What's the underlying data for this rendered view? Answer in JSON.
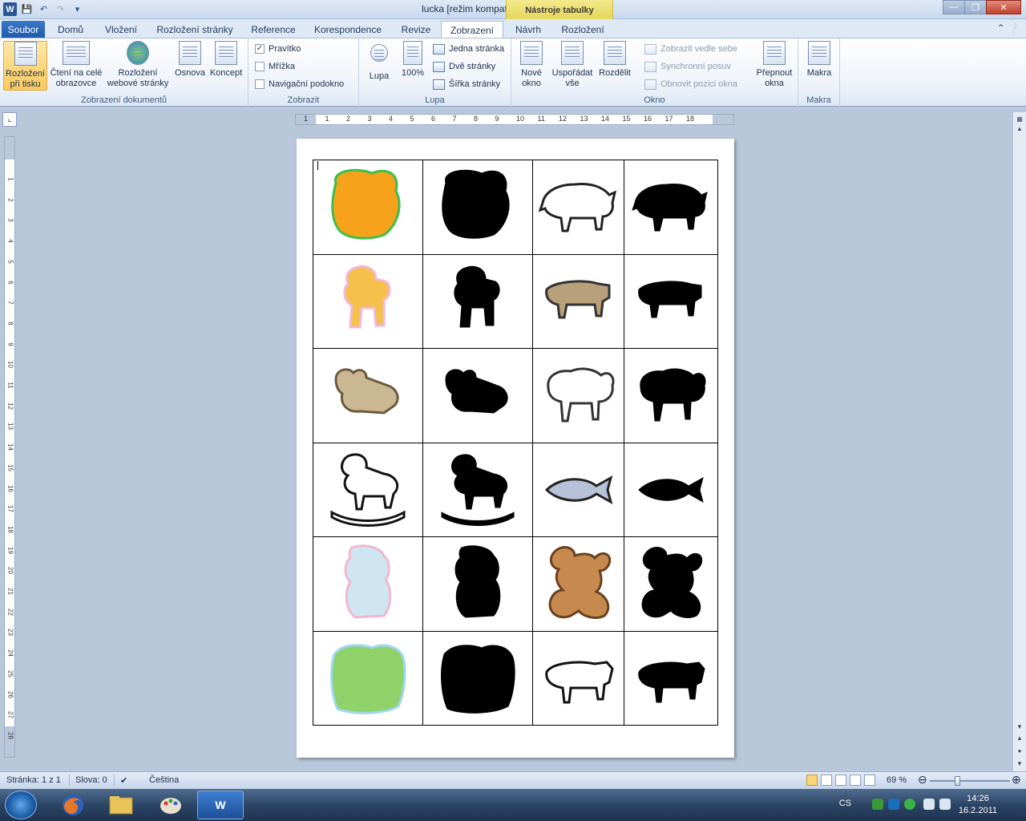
{
  "window": {
    "title": "lucka [režim kompatibility]  -  Microsoft Word",
    "contextual_tab": "Nástroje tabulky"
  },
  "tabs": {
    "file": "Soubor",
    "items": [
      "Domů",
      "Vložení",
      "Rozložení stránky",
      "Reference",
      "Korespondence",
      "Revize",
      "Zobrazení",
      "Návrh",
      "Rozložení"
    ],
    "active": "Zobrazení"
  },
  "ribbon": {
    "doc_views": {
      "label": "Zobrazení dokumentů",
      "print_layout": "Rozložení\npři tisku",
      "full_screen": "Čtení na celé\nobrazovce",
      "web_layout": "Rozložení\nwebové stránky",
      "outline": "Osnova",
      "draft": "Koncept"
    },
    "show": {
      "label": "Zobrazit",
      "ruler": "Pravítko",
      "ruler_checked": true,
      "gridlines": "Mřížka",
      "gridlines_checked": false,
      "nav_pane": "Navigační podokno",
      "nav_pane_checked": false
    },
    "zoom": {
      "label": "Lupa",
      "zoom": "Lupa",
      "hundred": "100%",
      "one_page": "Jedna stránka",
      "two_pages": "Dvě stránky",
      "page_width": "Šířka stránky"
    },
    "window": {
      "label": "Okno",
      "new_window": "Nové\nokno",
      "arrange_all": "Uspořádat\nvše",
      "split": "Rozdělit",
      "side_by_side": "Zobrazit vedle sebe",
      "sync_scroll": "Synchronní posuv",
      "reset_position": "Obnovit pozici okna",
      "switch_windows": "Přepnout\nokna"
    },
    "macros": {
      "label": "Makra",
      "macros": "Makra"
    }
  },
  "ruler": {
    "h_numbers": [
      "1",
      "1",
      "2",
      "3",
      "4",
      "5",
      "6",
      "7",
      "8",
      "9",
      "10",
      "11",
      "12",
      "13",
      "14",
      "15",
      "16",
      "17",
      "18"
    ],
    "v_numbers": [
      "1",
      "2",
      "3",
      "4",
      "5",
      "6",
      "7",
      "8",
      "9",
      "10",
      "11",
      "12",
      "13",
      "14",
      "15",
      "16",
      "17",
      "18",
      "19",
      "20",
      "21",
      "22",
      "23",
      "24",
      "25",
      "26",
      "27",
      "28"
    ]
  },
  "document": {
    "table_rows": [
      [
        {
          "name": "cat",
          "kind": "color"
        },
        {
          "name": "cat",
          "kind": "shadow"
        },
        {
          "name": "boar",
          "kind": "color"
        },
        {
          "name": "boar",
          "kind": "shadow"
        }
      ],
      [
        {
          "name": "toy-horse",
          "kind": "color"
        },
        {
          "name": "toy-horse",
          "kind": "shadow"
        },
        {
          "name": "cow",
          "kind": "color"
        },
        {
          "name": "cow",
          "kind": "shadow"
        }
      ],
      [
        {
          "name": "teddy-lying",
          "kind": "color"
        },
        {
          "name": "teddy-lying",
          "kind": "shadow"
        },
        {
          "name": "sheep",
          "kind": "color"
        },
        {
          "name": "sheep",
          "kind": "shadow"
        }
      ],
      [
        {
          "name": "rocking-horse",
          "kind": "color"
        },
        {
          "name": "rocking-horse",
          "kind": "shadow"
        },
        {
          "name": "fish",
          "kind": "color"
        },
        {
          "name": "fish",
          "kind": "shadow"
        }
      ],
      [
        {
          "name": "polar-bear",
          "kind": "color"
        },
        {
          "name": "polar-bear",
          "kind": "shadow"
        },
        {
          "name": "teddy-bear",
          "kind": "color"
        },
        {
          "name": "teddy-bear",
          "kind": "shadow"
        }
      ],
      [
        {
          "name": "horses-landscape",
          "kind": "color"
        },
        {
          "name": "horses-landscape",
          "kind": "shadow"
        },
        {
          "name": "milking-cow",
          "kind": "color"
        },
        {
          "name": "milking-cow",
          "kind": "shadow"
        }
      ]
    ]
  },
  "status": {
    "page": "Stránka: 1 z 1",
    "words": "Slova: 0",
    "language": "Čeština",
    "zoom": "69 %",
    "zoom_percent": 69
  },
  "taskbar": {
    "lang": "CS",
    "time": "14:26",
    "date": "16.2.2011"
  },
  "colors": {
    "file_tab": "#1e5aaa",
    "contextual": "#e6d85e",
    "active_view": "#f9c95c"
  }
}
